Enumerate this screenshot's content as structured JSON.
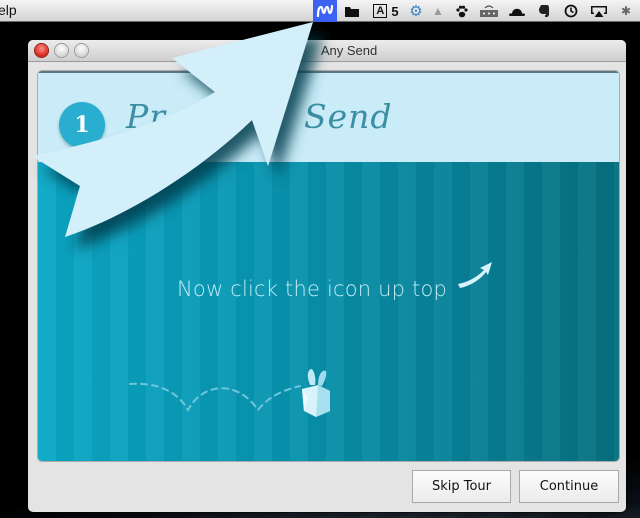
{
  "menubar": {
    "app_menu_partial": "elp",
    "status_icons": [
      {
        "name": "anysend-icon",
        "glyph": "ψ",
        "active": true
      },
      {
        "name": "folder-icon",
        "glyph": "▬"
      },
      {
        "name": "adobe-icon",
        "glyph": "A",
        "badge": "5"
      },
      {
        "name": "dropbox-sync-icon",
        "glyph": "⚙"
      },
      {
        "name": "google-drive-icon",
        "glyph": "▲"
      },
      {
        "name": "paw-icon",
        "glyph": "☘"
      },
      {
        "name": "network-icon",
        "glyph": "∷"
      },
      {
        "name": "bowler-hat-icon",
        "glyph": "◓"
      },
      {
        "name": "evernote-icon",
        "glyph": "❦"
      },
      {
        "name": "time-machine-icon",
        "glyph": "◷"
      },
      {
        "name": "airplay-icon",
        "glyph": "▭"
      },
      {
        "name": "bluetooth-icon",
        "glyph": "✱"
      }
    ]
  },
  "window": {
    "title": "Any Send",
    "header": {
      "step_number": "1",
      "title_left_partial": "Pr",
      "title_right": "Send"
    },
    "body": {
      "instruction": "Now click the icon up top"
    },
    "buttons": {
      "skip": "Skip Tour",
      "continue": "Continue"
    }
  },
  "colors": {
    "accent": "#2aaed0",
    "header_bg": "#c9ecf8",
    "body_teal": "#0892ad",
    "menubar_highlight": "#3b62f2"
  }
}
